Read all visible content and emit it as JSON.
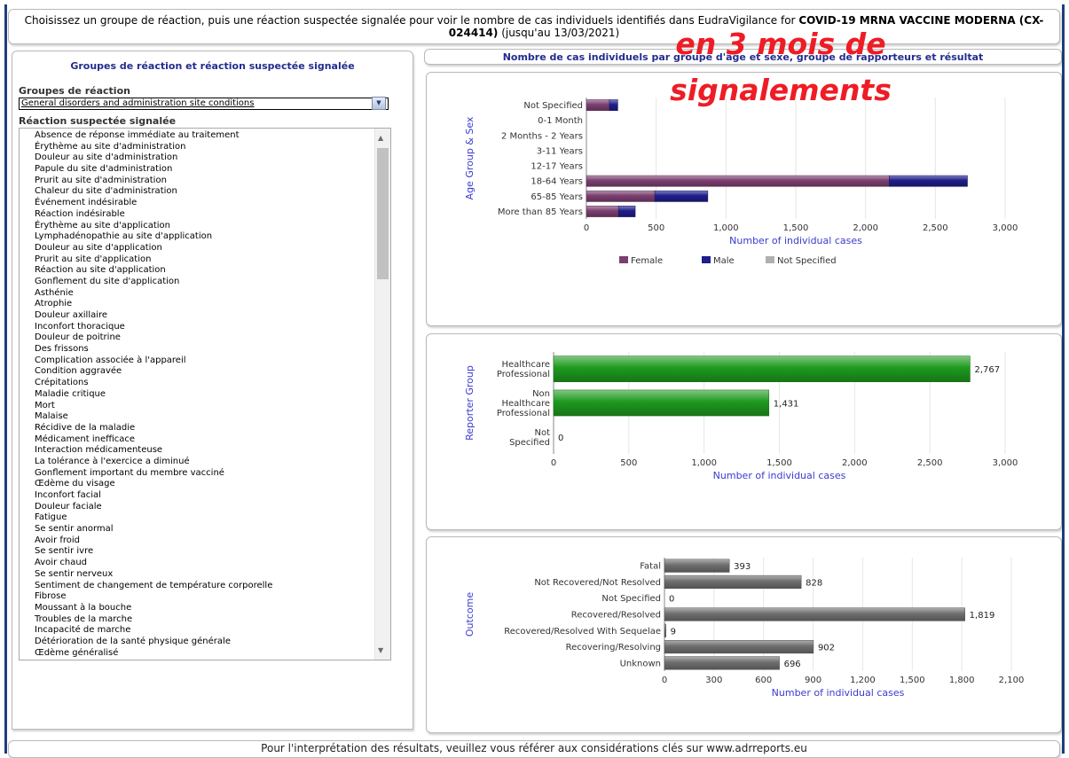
{
  "header": {
    "text_pre": "Choisissez un groupe de réaction, puis une réaction suspectée signalée pour voir le nombre de cas individuels identifiés dans EudraVigilance for ",
    "product": "COVID-19 MRNA VACCINE MODERNA (CX-024414)",
    "text_post": " (jusqu'au 13/03/2021)"
  },
  "overlay": {
    "line1": "en 3 mois de",
    "line2": "signalements",
    "color": "#ee1c25"
  },
  "left_panel": {
    "title": "Groupes de réaction et réaction suspectée signalée",
    "group_label": "Groupes de réaction",
    "group_selected": "General disorders and administration site conditions",
    "reaction_label": "Réaction suspectée signalée",
    "reactions": [
      "Absence de réponse immédiate au traitement",
      "Érythème au site d'administration",
      "Douleur au site d'administration",
      "Papule du site d'administration",
      "Prurit au site d'administration",
      "Chaleur du site d'administration",
      "Événement indésirable",
      "Réaction indésirable",
      "Érythème au site d'application",
      "Lymphadénopathie au site d'application",
      "Douleur au site d'application",
      "Prurit au site d'application",
      "Réaction au site d'application",
      "Gonflement du site d'application",
      "Asthénie",
      "Atrophie",
      "Douleur axillaire",
      "Inconfort thoracique",
      "Douleur de poitrine",
      "Des frissons",
      "Complication associée à l'appareil",
      "Condition aggravée",
      "Crépitations",
      "Maladie critique",
      "Mort",
      "Malaise",
      "Récidive de la maladie",
      "Médicament inefficace",
      "Interaction médicamenteuse",
      "La tolérance à l'exercice a diminué",
      "Gonflement important du membre vacciné",
      "Œdème du visage",
      "Inconfort facial",
      "Douleur faciale",
      "Fatigue",
      "Se sentir anormal",
      "Avoir froid",
      "Se sentir ivre",
      "Avoir chaud",
      "Se sentir nerveux",
      "Sentiment de changement de température corporelle",
      "Fibrose",
      "Moussant à la bouche",
      "Troubles de la marche",
      "Incapacité de marche",
      "Détérioration de la santé physique générale",
      "Œdème généralisé"
    ]
  },
  "charts_header": {
    "title": "Nombre de cas individuels par groupe d'âge et sexe, groupe de rapporteurs et résultat"
  },
  "footer": {
    "text": "Pour l'interprétation des résultats, veuillez vous référer aux considérations clés sur www.adrreports.eu"
  },
  "colors": {
    "female": "#7b3f70",
    "male": "#1f1e8a",
    "not_specified": "#b0b0b0",
    "green": "#1e9a1e",
    "gray_bar": "#6e6e6e",
    "axis_label": "#3b3bd0"
  },
  "chart_data": [
    {
      "type": "bar",
      "orientation": "horizontal",
      "stacked": true,
      "ylabel": "Age Group & Sex",
      "xlabel": "Number of individual cases",
      "categories": [
        "Not Specified",
        "0-1 Month",
        "2 Months - 2 Years",
        "3-11 Years",
        "12-17 Years",
        "18-64 Years",
        "65-85 Years",
        "More than 85 Years"
      ],
      "series": [
        {
          "name": "Female",
          "values": [
            165,
            0,
            0,
            0,
            0,
            2170,
            490,
            230
          ]
        },
        {
          "name": "Male",
          "values": [
            60,
            0,
            0,
            0,
            0,
            560,
            380,
            120
          ]
        },
        {
          "name": "Not Specified",
          "values": [
            0,
            0,
            0,
            0,
            0,
            0,
            0,
            0
          ]
        }
      ],
      "xlim": [
        0,
        3000
      ],
      "xticks": [
        "0",
        "500",
        "1,000",
        "1,500",
        "2,000",
        "2,500",
        "3,000"
      ],
      "legend": "bottom",
      "grid": true
    },
    {
      "type": "bar",
      "orientation": "horizontal",
      "ylabel": "Reporter Group",
      "xlabel": "Number of individual cases",
      "categories": [
        "Healthcare Professional",
        "Non Healthcare Professional",
        "Not Specified"
      ],
      "values": [
        2767,
        1431,
        0
      ],
      "value_labels": [
        "2,767",
        "1,431",
        "0"
      ],
      "xlim": [
        0,
        3000
      ],
      "xticks": [
        "0",
        "500",
        "1,000",
        "1,500",
        "2,000",
        "2,500",
        "3,000"
      ],
      "grid": true
    },
    {
      "type": "bar",
      "orientation": "horizontal",
      "ylabel": "Outcome",
      "xlabel": "Number of individual cases",
      "categories": [
        "Fatal",
        "Not Recovered/Not Resolved",
        "Not Specified",
        "Recovered/Resolved",
        "Recovered/Resolved With Sequelae",
        "Recovering/Resolving",
        "Unknown"
      ],
      "values": [
        393,
        828,
        0,
        1819,
        9,
        902,
        696
      ],
      "value_labels": [
        "393",
        "828",
        "0",
        "1,819",
        "9",
        "902",
        "696"
      ],
      "xlim": [
        0,
        2100
      ],
      "xticks": [
        "0",
        "300",
        "600",
        "900",
        "1,200",
        "1,500",
        "1,800",
        "2,100"
      ],
      "grid": true
    }
  ]
}
